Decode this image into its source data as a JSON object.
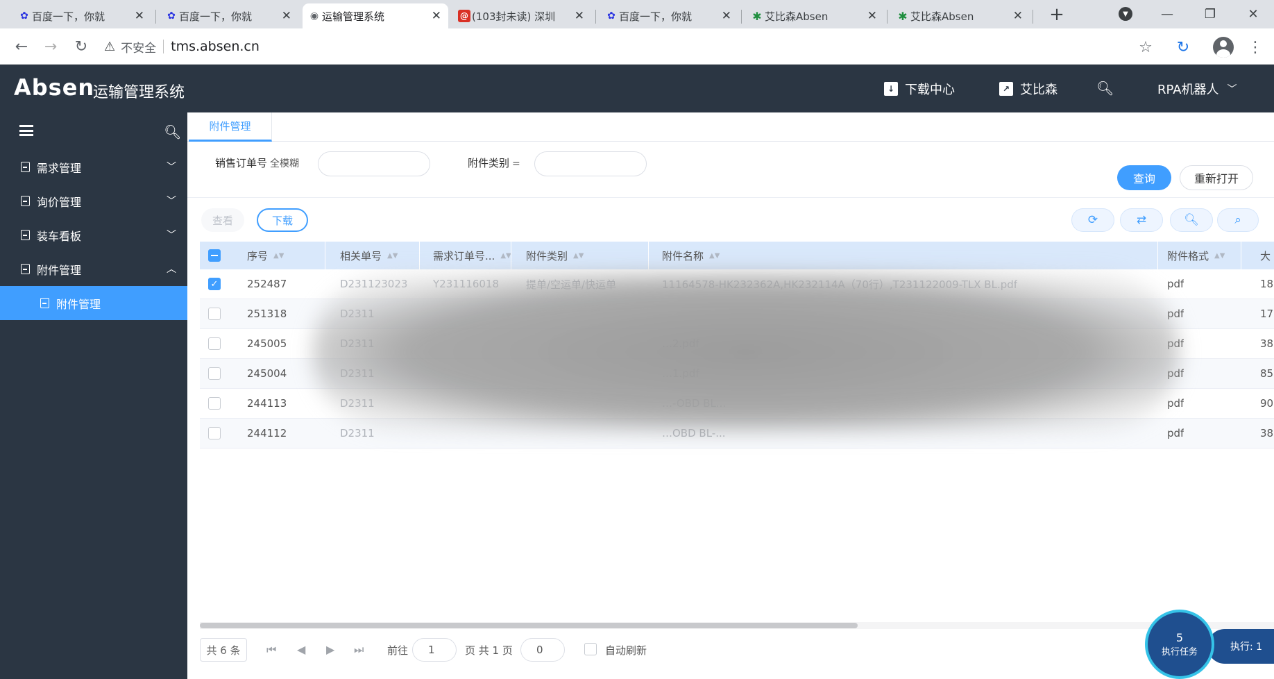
{
  "browser": {
    "tabs": [
      {
        "label": "百度一下，你就",
        "icon": "baidu-icon",
        "active": false
      },
      {
        "label": "百度一下，你就",
        "icon": "baidu-icon",
        "active": false
      },
      {
        "label": "运输管理系统",
        "icon": "globe-icon",
        "active": true
      },
      {
        "label": "(103封未读) 深圳",
        "icon": "mail-icon",
        "active": false
      },
      {
        "label": "百度一下，你就",
        "icon": "baidu-icon",
        "active": false
      },
      {
        "label": "艾比森Absen",
        "icon": "absen-icon",
        "active": false
      },
      {
        "label": "艾比森Absen",
        "icon": "absen-icon",
        "active": false
      }
    ],
    "insecure_label": "不安全",
    "url": "tms.absen.cn"
  },
  "header": {
    "logo": "Absen",
    "system_name": "运输管理系统",
    "download_center": "下载中心",
    "absen_link": "艾比森",
    "user": "RPA机器人"
  },
  "sidebar": {
    "items": [
      {
        "label": "需求管理",
        "expanded": false
      },
      {
        "label": "询价管理",
        "expanded": false
      },
      {
        "label": "装车看板",
        "expanded": false
      },
      {
        "label": "附件管理",
        "expanded": true
      }
    ],
    "active_sub_item": "附件管理"
  },
  "main": {
    "page_tab": "附件管理",
    "filters": {
      "sales_order_label": "销售订单号",
      "sales_order_op": "全模糊",
      "attachment_type_label": "附件类别",
      "attachment_type_op": "="
    },
    "query_button": "查询",
    "reset_button": "重新打开",
    "view_button": "查看",
    "download_button": "下载",
    "table": {
      "columns": [
        "序号",
        "相关单号",
        "需求订单号...",
        "附件类别",
        "附件名称",
        "附件格式",
        "大"
      ],
      "rows": [
        {
          "checked": true,
          "id": "252487",
          "ref": "D231123023",
          "order": "Y231116018",
          "type": "提单/空运单/快运单",
          "name": "11164578-HK232362A,HK232114A（70行）,T231122009-TLX BL.pdf",
          "format": "pdf",
          "size": "18"
        },
        {
          "checked": false,
          "id": "251318",
          "ref": "D2311",
          "order": "",
          "type": "",
          "name": "",
          "format": "pdf",
          "size": "17"
        },
        {
          "checked": false,
          "id": "245005",
          "ref": "D2311",
          "order": "",
          "type": "",
          "name": "…2.pdf",
          "format": "pdf",
          "size": "38"
        },
        {
          "checked": false,
          "id": "245004",
          "ref": "D2311",
          "order": "",
          "type": "",
          "name": "…1.pdf",
          "format": "pdf",
          "size": "85"
        },
        {
          "checked": false,
          "id": "244113",
          "ref": "D2311",
          "order": "",
          "type": "",
          "name": "…-OBD BL...",
          "format": "pdf",
          "size": "90"
        },
        {
          "checked": false,
          "id": "244112",
          "ref": "D2311",
          "order": "",
          "type": "",
          "name": "…OBD BL-...",
          "format": "pdf",
          "size": "38"
        }
      ]
    },
    "pager": {
      "total": "共 6 条",
      "goto_label": "前往",
      "page_value": "1",
      "of_pages": "页 共 1 页",
      "interval_value": "0",
      "auto_refresh": "自动刷新"
    }
  },
  "float": {
    "task_count": "5",
    "task_label": "执行任务",
    "exec_label": "执行: 1"
  },
  "colors": {
    "primary": "#409eff",
    "header_bg": "#2b3643"
  }
}
